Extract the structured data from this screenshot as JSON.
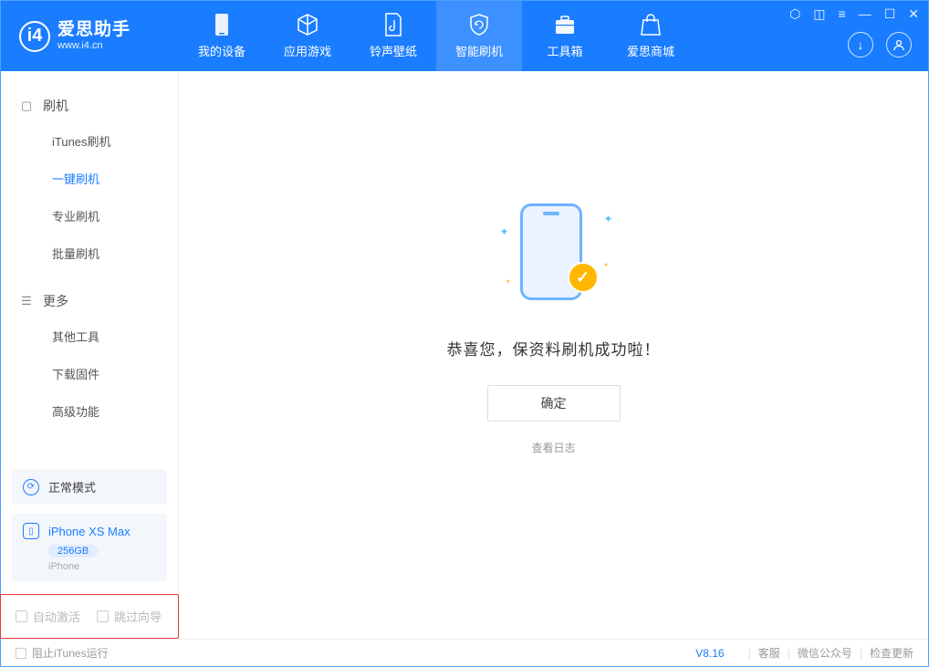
{
  "logo": {
    "title": "爱思助手",
    "subtitle": "www.i4.cn"
  },
  "nav": [
    {
      "label": "我的设备"
    },
    {
      "label": "应用游戏"
    },
    {
      "label": "铃声壁纸"
    },
    {
      "label": "智能刷机"
    },
    {
      "label": "工具箱"
    },
    {
      "label": "爱思商城"
    }
  ],
  "sidebar": {
    "group1": {
      "title": "刷机",
      "items": [
        "iTunes刷机",
        "一键刷机",
        "专业刷机",
        "批量刷机"
      ]
    },
    "group2": {
      "title": "更多",
      "items": [
        "其他工具",
        "下载固件",
        "高级功能"
      ]
    }
  },
  "mode": {
    "label": "正常模式"
  },
  "device": {
    "name": "iPhone XS Max",
    "storage": "256GB",
    "type": "iPhone"
  },
  "checks": {
    "auto_activate": "自动激活",
    "skip_wizard": "跳过向导"
  },
  "main": {
    "success_msg": "恭喜您，保资料刷机成功啦！",
    "confirm": "确定",
    "view_log": "查看日志"
  },
  "footer": {
    "block_itunes": "阻止iTunes运行",
    "version": "V8.16",
    "service": "客服",
    "wechat": "微信公众号",
    "update": "检查更新"
  }
}
